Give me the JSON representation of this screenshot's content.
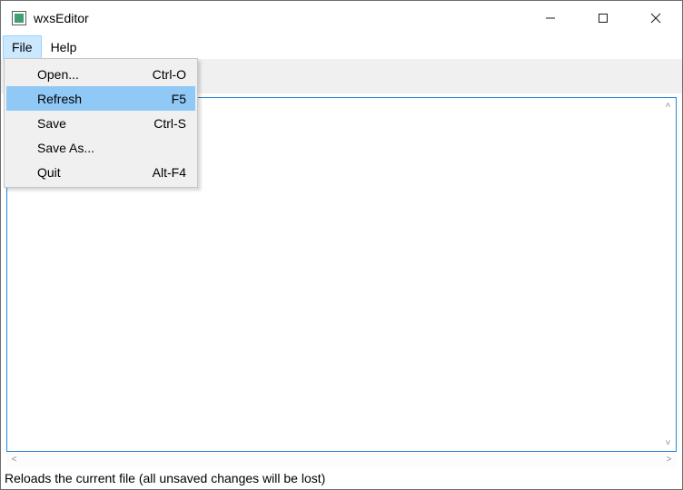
{
  "window": {
    "title": "wxsEditor"
  },
  "menubar": {
    "items": [
      {
        "label": "File",
        "open": true
      },
      {
        "label": "Help",
        "open": false
      }
    ]
  },
  "file_menu": {
    "items": [
      {
        "label": "Open...",
        "accel": "Ctrl-O",
        "selected": false
      },
      {
        "label": "Refresh",
        "accel": "F5",
        "selected": true
      },
      {
        "label": "Save",
        "accel": "Ctrl-S",
        "selected": false
      },
      {
        "label": "Save As...",
        "accel": "",
        "selected": false
      },
      {
        "label": "Quit",
        "accel": "Alt-F4",
        "selected": false
      }
    ]
  },
  "status": {
    "text": "Reloads the current file (all unsaved changes will be lost)"
  }
}
